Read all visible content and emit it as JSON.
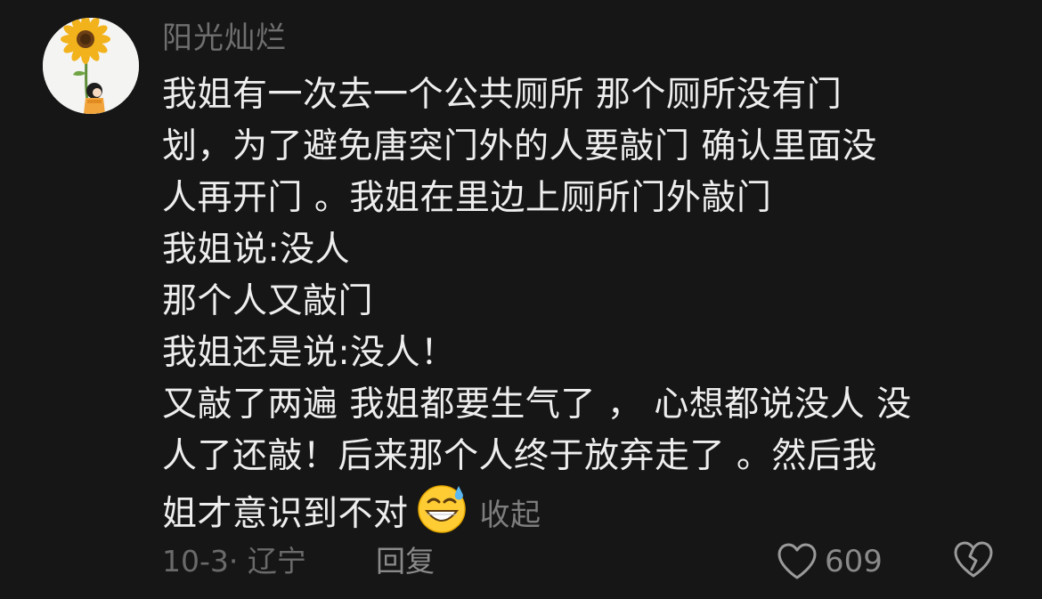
{
  "comment": {
    "username": "阳光灿烂",
    "lines": [
      "我姐有一次去一个公共厕所 那个厕所没有门",
      "划，为了避免唐突门外的人要敲门 确认里面没",
      "人再开门 。我姐在里边上厕所门外敲门",
      "我姐说:没人",
      "那个人又敲门",
      "我姐还是说:没人！",
      "又敲了两遍 我姐都要生气了 ， 心想都说没人 没",
      "人了还敲！后来那个人终于放弃走了 。然后我",
      "姐才意识到不对"
    ],
    "emoji": "grinning-sweat-emoji",
    "collapse_label": "收起",
    "meta": "10-3· 辽宁",
    "reply_label": "回复",
    "like_count": "609"
  },
  "icons": {
    "like": "heart-icon",
    "dislike": "broken-heart-icon",
    "avatar": "sunflower-girl-avatar"
  },
  "colors": {
    "background": "#161616",
    "text": "#eeeeee",
    "muted": "#6f6f6f"
  }
}
